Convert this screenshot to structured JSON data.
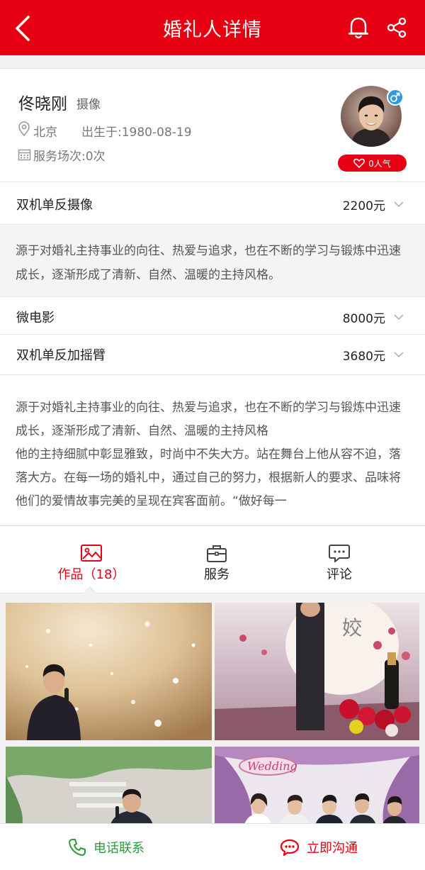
{
  "header": {
    "title": "婚礼人详情",
    "back_icon": "chevron-left-icon",
    "notify_icon": "bell-icon",
    "share_icon": "share-icon",
    "bg_color": "#e60012"
  },
  "profile": {
    "name": "佟晓刚",
    "role": "摄像",
    "location": "北京",
    "birth": "出生于:1980-08-19",
    "sessions": "服务场次:0次",
    "popularity": "0人气",
    "gender_symbol": "♂"
  },
  "services": [
    {
      "name": "双机单反摄像",
      "price": "2200元"
    },
    {
      "name": "微电影",
      "price": "8000元"
    },
    {
      "name": "双机单反加摇臂",
      "price": "3680元"
    }
  ],
  "service_desc": "源于对婚礼主持事业的向往、热爱与追求，也在不断的学习与锻炼中迅速成长，逐渐形成了清新、自然、温暖的主持风格。",
  "bio": {
    "p1": "源于对婚礼主持事业的向往、热爱与追求，也在不断的学习与锻炼中迅速成长，逐渐形成了清新、自然、温暖的主持风格",
    "p2": "他的主持细腻中彰显雅致，时尚中不失大方。站在舞台上他从容不迫，落落大方。在每一场的婚礼中，通过自己的努力，根据新人的要求、品味将他们的爱情故事完美的呈现在宾客面前。“做好每一"
  },
  "tabs": [
    {
      "label": "作品（18）",
      "icon": "image-icon",
      "active": true
    },
    {
      "label": "服务",
      "icon": "briefcase-icon",
      "active": false
    },
    {
      "label": "评论",
      "icon": "comment-icon",
      "active": false
    }
  ],
  "gallery_sign": "Wedding",
  "actions": {
    "call": "电话联系",
    "chat": "立即沟通"
  },
  "colors": {
    "accent": "#e60012",
    "call_green": "#2c9a3c",
    "male_blue": "#2f9ae0"
  }
}
